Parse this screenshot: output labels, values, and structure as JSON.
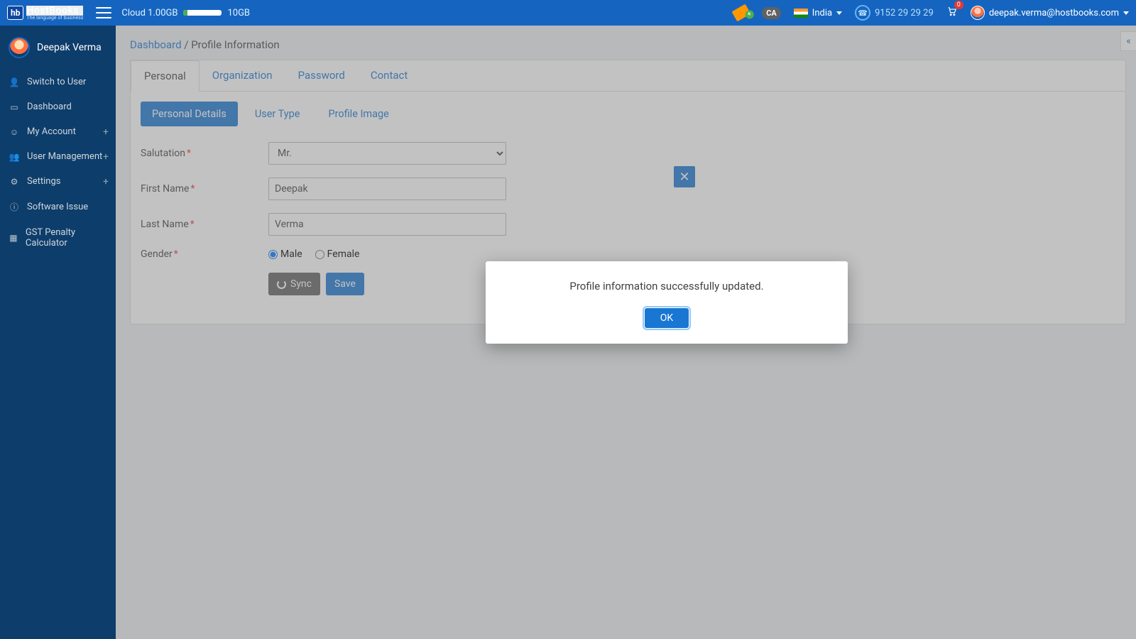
{
  "header": {
    "logo_hb": "hb",
    "logo_main": "HostBooks",
    "logo_sub": "The language of business",
    "cloud_used": "Cloud 1.00GB",
    "cloud_total": "10GB",
    "ca_badge": "CA",
    "country": "India",
    "support_phone": "9152 29 29 29",
    "cart_count": "0",
    "user_email": "deepak.verma@hostbooks.com"
  },
  "sidebar": {
    "user_name": "Deepak Verma",
    "items": [
      {
        "icon": "👤",
        "label": "Switch to User",
        "expand": false
      },
      {
        "icon": "▭",
        "label": "Dashboard",
        "expand": false
      },
      {
        "icon": "☺",
        "label": "My Account",
        "expand": true
      },
      {
        "icon": "👥",
        "label": "User Management",
        "expand": true
      },
      {
        "icon": "⚙",
        "label": "Settings",
        "expand": true
      },
      {
        "icon": "ⓘ",
        "label": "Software Issue",
        "expand": false
      },
      {
        "icon": "▦",
        "label": "GST Penalty Calculator",
        "expand": false
      }
    ]
  },
  "breadcrumb": {
    "root": "Dashboard",
    "sep": " / ",
    "current": "Profile Information"
  },
  "tabs": {
    "items": [
      "Personal",
      "Organization",
      "Password",
      "Contact"
    ],
    "active": 0
  },
  "subtabs": {
    "items": [
      "Personal Details",
      "User Type",
      "Profile Image"
    ],
    "active": 0
  },
  "form": {
    "salutation": {
      "label": "Salutation",
      "value": "Mr."
    },
    "first_name": {
      "label": "First Name",
      "value": "Deepak"
    },
    "last_name": {
      "label": "Last Name",
      "value": "Verma"
    },
    "gender": {
      "label": "Gender",
      "options": [
        "Male",
        "Female"
      ],
      "selected": "Male"
    },
    "sync_label": "Sync",
    "save_label": "Save"
  },
  "modal": {
    "message": "Profile information successfully updated.",
    "ok_label": "OK"
  },
  "close_x": "✕",
  "right_handle": "«"
}
